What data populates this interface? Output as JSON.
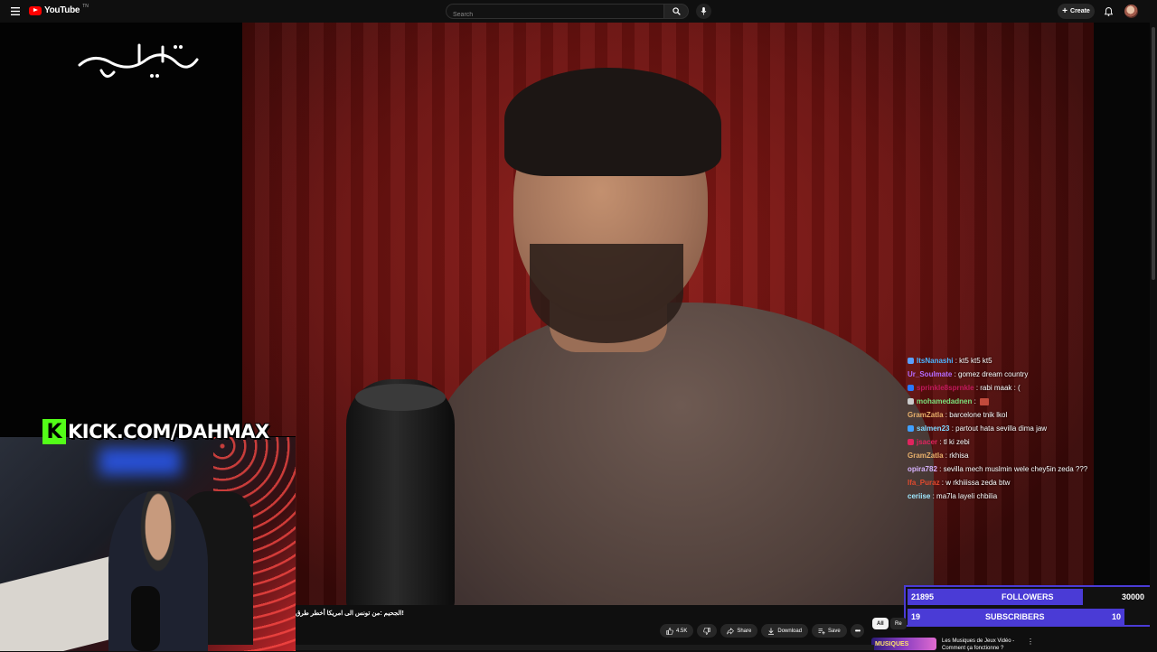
{
  "header": {
    "logo_text": "YouTube",
    "country_code": "TN",
    "search_placeholder": "Search",
    "create_label": "Create"
  },
  "video": {
    "channel_watermark": "حكايات",
    "title": "!الجحيم :من تونس الى امريكا أخطر طرق"
  },
  "stream_overlay": {
    "kick_handle": "KICK.COM/DAHMAX",
    "chat": [
      {
        "user": "ItsNanashi",
        "message": "kt5 kt5 kt5",
        "color": "#4ab3ff",
        "badge": "#5aa0ff"
      },
      {
        "user": "Ur_Soulmate",
        "message": "gomez dream country",
        "color": "#b36bff",
        "badge": ""
      },
      {
        "user": "sprinkle8sprnkle",
        "message": "rabi maak : (",
        "color": "#c2185b",
        "badge": "#2979ff"
      },
      {
        "user": "mohamedadnen",
        "message": "",
        "color": "#7be07b",
        "badge": "#cccccc"
      },
      {
        "user": "GramZatla",
        "message": "barcelone tnik lkol",
        "color": "#e8b06b",
        "badge": ""
      },
      {
        "user": "salmen23",
        "message": "partout hata sevilla dima jaw",
        "color": "#7fd7ff",
        "badge": "#3fa0ff"
      },
      {
        "user": "jsacer",
        "message": "tl ki zebi",
        "color": "#e0245e",
        "badge": "#e0245e"
      },
      {
        "user": "GramZatla",
        "message": "rkhisa",
        "color": "#e8b06b",
        "badge": ""
      },
      {
        "user": "opira782",
        "message": "sevilla mech muslmin wele chey5in zeda ???",
        "color": "#d7b3ff",
        "badge": ""
      },
      {
        "user": "Ifa_Puraz",
        "message": "w rkhiiissa zeda btw",
        "color": "#e04a2e",
        "badge": ""
      },
      {
        "user": "ceriise",
        "message": "ma7la layeli chbilia",
        "color": "#9fe8ff",
        "badge": ""
      }
    ],
    "goals": {
      "followers": {
        "current": "21895",
        "label": "FOLLOWERS",
        "target": "30000",
        "progress": 0.73
      },
      "subscribers": {
        "current": "19",
        "label": "SUBSCRIBERS",
        "target": "10",
        "progress": 1.0
      }
    }
  },
  "actions": {
    "like_count": "4.5K",
    "share_label": "Share",
    "download_label": "Download",
    "save_label": "Save"
  },
  "sidebar": {
    "chip_all": "All",
    "chip_related": "Re",
    "rec_thumb_text": "MUSIQUES",
    "rec_title": "Les Musiques de Jeux Vidéo - Comment ça fonctionne ?"
  },
  "colors": {
    "accent": "#ff0000",
    "kick": "#53fc18",
    "goal_bar": "#4a3bd6"
  }
}
